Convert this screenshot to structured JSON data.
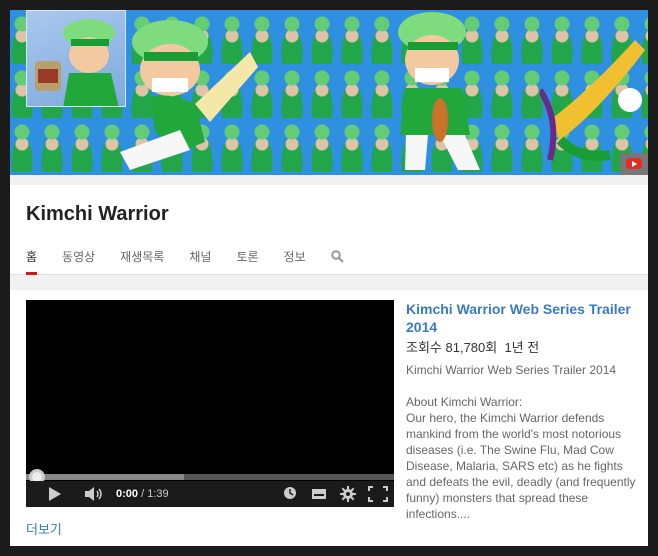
{
  "banner": {
    "icon": "youtube-icon"
  },
  "channel": {
    "title": "Kimchi Warrior"
  },
  "tabs": [
    {
      "label": "홈"
    },
    {
      "label": "동영상"
    },
    {
      "label": "재생목록"
    },
    {
      "label": "채널"
    },
    {
      "label": "토론"
    },
    {
      "label": "정보"
    }
  ],
  "search": {
    "icon": "search-icon"
  },
  "video": {
    "title": "Kimchi Warrior Web Series Trailer 2014",
    "views": "조회수 81,780회",
    "age": "1년 전",
    "description_title": "Kimchi Warrior Web Series Trailer 2014",
    "description_lines": [
      "About Kimchi Warrior:",
      "Our hero, the Kimchi Warrior defends mankind from the world's most notorious diseases (i.e. The Swine Flu, Mad Cow Disease, Malaria, SARS etc) as he fights and defeats the evil, deadly (and frequently funny) monsters that spread these infections...."
    ],
    "current_time": "0:00",
    "duration": "1:39",
    "buffered_fraction": 0.43,
    "played_fraction": 0.0
  },
  "more_link": "더보기",
  "colors": {
    "accent": "#cc181e",
    "link": "#3a7bc0"
  }
}
